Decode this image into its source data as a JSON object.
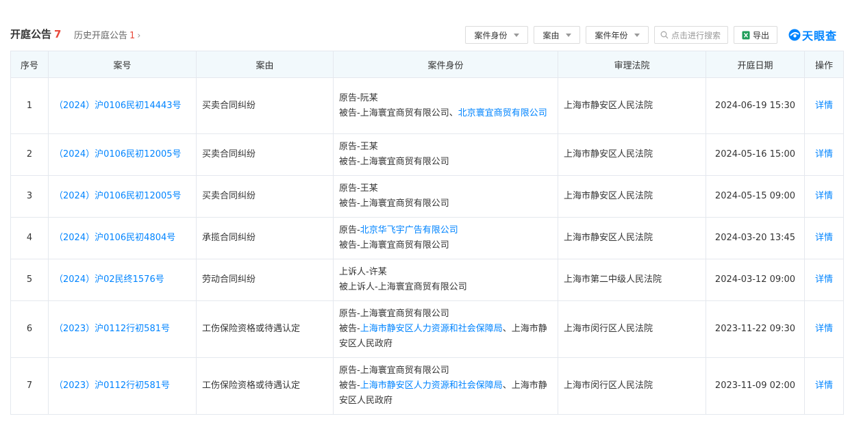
{
  "header": {
    "title": "开庭公告",
    "title_count": "7",
    "history_label": "历史开庭公告",
    "history_count": "1",
    "chevron": "›"
  },
  "filters": [
    {
      "label": "案件身份"
    },
    {
      "label": "案由"
    },
    {
      "label": "案件年份"
    }
  ],
  "search": {
    "placeholder": "点击进行搜索"
  },
  "export_label": "导出",
  "logo_text": "天眼查",
  "colors": {
    "accent": "#0084ff",
    "count_red": "#e84a3c",
    "header_bg": "#f2f9fc",
    "border": "#e4e8ee"
  },
  "table": {
    "columns": [
      "序号",
      "案号",
      "案由",
      "案件身份",
      "审理法院",
      "开庭日期",
      "操作"
    ],
    "rows": [
      {
        "idx": "1",
        "case_no": "（2024）沪0106民初14443号",
        "cause": "买卖合同纠纷",
        "party_lines": [
          [
            {
              "t": "原告-阮某",
              "link": false
            }
          ],
          [
            {
              "t": "被告-上海寰宜商贸有限公司、",
              "link": false
            },
            {
              "t": "北京寰宜商贸有限公司",
              "link": true
            }
          ]
        ],
        "court": "上海市静安区人民法院",
        "date": "2024-06-19 15:30",
        "action": "详情"
      },
      {
        "idx": "2",
        "case_no": "（2024）沪0106民初12005号",
        "cause": "买卖合同纠纷",
        "party_lines": [
          [
            {
              "t": "原告-王某",
              "link": false
            }
          ],
          [
            {
              "t": "被告-上海寰宜商贸有限公司",
              "link": false
            }
          ]
        ],
        "court": "上海市静安区人民法院",
        "date": "2024-05-16 15:00",
        "action": "详情"
      },
      {
        "idx": "3",
        "case_no": "（2024）沪0106民初12005号",
        "cause": "买卖合同纠纷",
        "party_lines": [
          [
            {
              "t": "原告-王某",
              "link": false
            }
          ],
          [
            {
              "t": "被告-上海寰宜商贸有限公司",
              "link": false
            }
          ]
        ],
        "court": "上海市静安区人民法院",
        "date": "2024-05-15 09:00",
        "action": "详情"
      },
      {
        "idx": "4",
        "case_no": "（2024）沪0106民初4804号",
        "cause": "承揽合同纠纷",
        "party_lines": [
          [
            {
              "t": "原告-",
              "link": false
            },
            {
              "t": "北京华飞宇广告有限公司",
              "link": true
            }
          ],
          [
            {
              "t": "被告-上海寰宜商贸有限公司",
              "link": false
            }
          ]
        ],
        "court": "上海市静安区人民法院",
        "date": "2024-03-20 13:45",
        "action": "详情"
      },
      {
        "idx": "5",
        "case_no": "（2024）沪02民终1576号",
        "cause": "劳动合同纠纷",
        "party_lines": [
          [
            {
              "t": "上诉人-许某",
              "link": false
            }
          ],
          [
            {
              "t": "被上诉人-上海寰宜商贸有限公司",
              "link": false
            }
          ]
        ],
        "court": "上海市第二中级人民法院",
        "date": "2024-03-12 09:00",
        "action": "详情"
      },
      {
        "idx": "6",
        "case_no": "（2023）沪0112行初581号",
        "cause": "工伤保险资格或待遇认定",
        "party_lines": [
          [
            {
              "t": "原告-上海寰宜商贸有限公司",
              "link": false
            }
          ],
          [
            {
              "t": "被告-",
              "link": false
            },
            {
              "t": "上海市静安区人力资源和社会保障局",
              "link": true
            },
            {
              "t": "、上海市静安区人民政府",
              "link": false
            }
          ]
        ],
        "court": "上海市闵行区人民法院",
        "date": "2023-11-22 09:30",
        "action": "详情"
      },
      {
        "idx": "7",
        "case_no": "（2023）沪0112行初581号",
        "cause": "工伤保险资格或待遇认定",
        "party_lines": [
          [
            {
              "t": "原告-上海寰宜商贸有限公司",
              "link": false
            }
          ],
          [
            {
              "t": "被告-",
              "link": false
            },
            {
              "t": "上海市静安区人力资源和社会保障局",
              "link": true
            },
            {
              "t": "、上海市静安区人民政府",
              "link": false
            }
          ]
        ],
        "court": "上海市闵行区人民法院",
        "date": "2023-11-09 02:00",
        "action": "详情"
      }
    ]
  }
}
